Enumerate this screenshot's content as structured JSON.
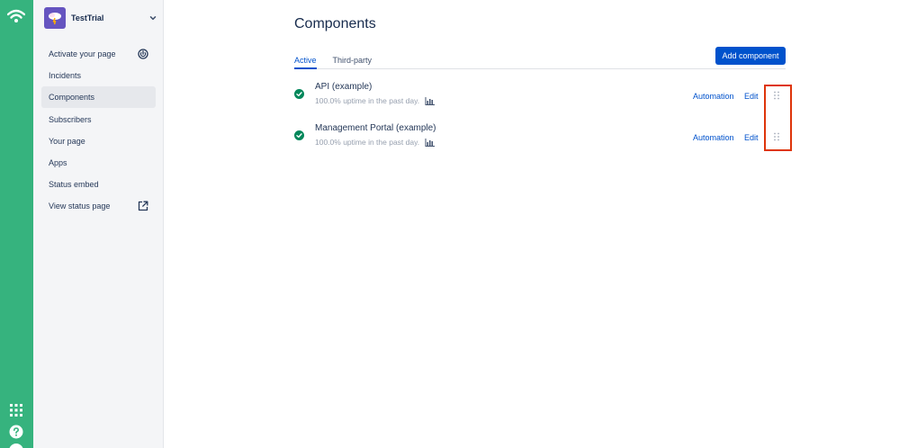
{
  "rail": {
    "logo_icon": "wifi-logo-icon",
    "apps_icon": "app-switcher-icon",
    "help_icon": "help-icon",
    "avatar_icon": "avatar"
  },
  "org": {
    "name": "TestTrial",
    "logo_icon": "org-logo-icon",
    "chevron_icon": "chevron-down-icon"
  },
  "sidebar": {
    "items": [
      {
        "label": "Activate your page",
        "icon": "power-icon",
        "active": false
      },
      {
        "label": "Incidents",
        "active": false
      },
      {
        "label": "Components",
        "active": true
      },
      {
        "label": "Subscribers",
        "active": false
      },
      {
        "label": "Your page",
        "active": false
      },
      {
        "label": "Apps",
        "active": false
      },
      {
        "label": "Status embed",
        "active": false
      },
      {
        "label": "View status page",
        "icon": "external-link-icon",
        "active": false
      }
    ]
  },
  "main": {
    "title": "Components",
    "add_button": "Add component",
    "tabs": [
      {
        "label": "Active",
        "active": true
      },
      {
        "label": "Third-party",
        "active": false
      }
    ],
    "components": [
      {
        "name": "API (example)",
        "uptime": "100.0% uptime in the past day.",
        "status": "operational",
        "automation_label": "Automation",
        "edit_label": "Edit"
      },
      {
        "name": "Management Portal (example)",
        "uptime": "100.0% uptime in the past day.",
        "status": "operational",
        "automation_label": "Automation",
        "edit_label": "Edit"
      }
    ]
  },
  "colors": {
    "rail": "#36b37e",
    "sidebar": "#f4f5f7",
    "primary": "#0052cc",
    "success": "#00875a",
    "highlight": "#de350b",
    "org_logo": "#6554c0"
  }
}
